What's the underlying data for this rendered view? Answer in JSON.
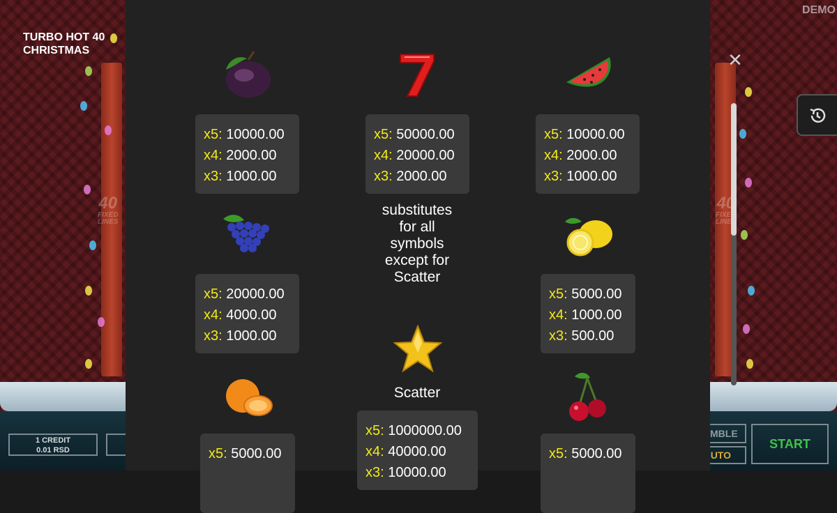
{
  "game": {
    "title_line1": "TURBO HOT 40",
    "title_line2": "CHRISTMAS",
    "mode_label": "DEMO",
    "fixed_lines_number": "40",
    "fixed_lines_text1": "FIXED",
    "fixed_lines_text2": "LINES"
  },
  "controls": {
    "credit_line1": "1 CREDIT",
    "credit_line2": "0.01 RSD",
    "gamble_label": "MBLE",
    "auto_label": "UTO",
    "start_label": "START"
  },
  "paytable": {
    "close_icon": "close-icon",
    "history_icon": "history-icon",
    "scroll_position": 0.0,
    "symbols": {
      "plum": {
        "icon": "plum-icon",
        "x5": "10000.00",
        "x4": "2000.00",
        "x3": "1000.00"
      },
      "seven": {
        "icon": "seven-icon",
        "x5": "50000.00",
        "x4": "20000.00",
        "x3": "2000.00",
        "description": [
          "substitutes",
          "for all",
          "symbols",
          "except for",
          "Scatter"
        ]
      },
      "watermelon": {
        "icon": "watermelon-icon",
        "x5": "10000.00",
        "x4": "2000.00",
        "x3": "1000.00"
      },
      "grapes": {
        "icon": "grapes-icon",
        "x5": "20000.00",
        "x4": "4000.00",
        "x3": "1000.00"
      },
      "lemon": {
        "icon": "lemon-icon",
        "x5": "5000.00",
        "x4": "1000.00",
        "x3": "500.00"
      },
      "star": {
        "icon": "star-icon",
        "label": "Scatter",
        "x5": "1000000.00",
        "x4": "40000.00",
        "x3": "10000.00"
      },
      "orange": {
        "icon": "orange-icon",
        "x5": "5000.00"
      },
      "cherry": {
        "icon": "cherry-icon",
        "x5": "5000.00"
      }
    },
    "multipliers": {
      "x5": "x5:",
      "x4": "x4:",
      "x3": "x3:"
    }
  },
  "colors": {
    "multiplier": "#f2ea1a",
    "panel": "#222222",
    "value_box": "#3a3a3a",
    "start": "#3fc24a"
  }
}
